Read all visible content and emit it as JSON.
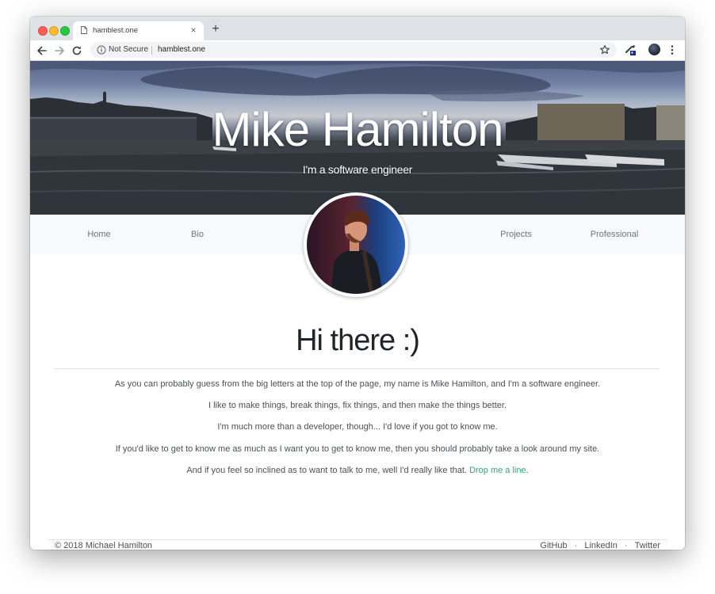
{
  "browser": {
    "tab_title": "hamblest.one",
    "tab_close": "×",
    "new_tab": "+",
    "not_secure": "Not Secure",
    "url": "hamblest.one",
    "icons": [
      "back-icon",
      "forward-icon",
      "reload-icon",
      "info-icon",
      "star-icon",
      "extension-icon",
      "profile-icon",
      "menu-icon"
    ]
  },
  "hero": {
    "title": "Mike Hamilton",
    "subtitle": "I'm a software engineer"
  },
  "nav": {
    "items": [
      {
        "label": "Home"
      },
      {
        "label": "Bio"
      },
      {
        "label": "Projects"
      },
      {
        "label": "Professional"
      }
    ]
  },
  "main": {
    "heading": "Hi there :)",
    "paragraphs": [
      "As you can probably guess from the big letters at the top of the page, my name is Mike Hamilton, and I'm a software engineer.",
      "I like to make things, break things, fix things, and then make the things better.",
      "I'm much more than a developer, though... I'd love if you got to know me.",
      "If you'd like to get to know me as much as I want you to get to know me, then you should probably take a look around my site."
    ],
    "last_paragraph_prefix": "And if you feel so inclined as to want to talk to me, well I'd really like that. ",
    "contact_link": "Drop me a line",
    "last_paragraph_suffix": "."
  },
  "footer": {
    "copyright": "© 2018 Michael Hamilton",
    "links": [
      "GitHub",
      "LinkedIn",
      "Twitter"
    ],
    "separator": "·"
  },
  "colors": {
    "link_accent": "#3aa36f",
    "nav_background": "#f8f9fa"
  }
}
